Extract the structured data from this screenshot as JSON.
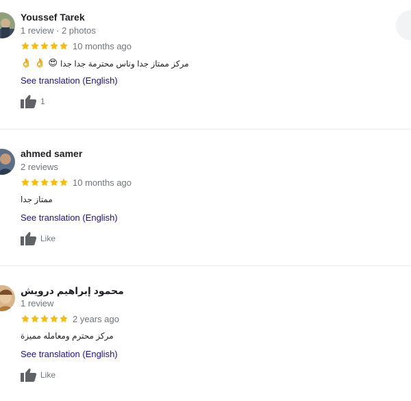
{
  "reviews": [
    {
      "author": "Youssef Tarek",
      "meta": "1 review · 2 photos",
      "rating": 5,
      "date": "10 months ago",
      "text": "مركز ممتاز جدا وناس محترمة جدا جدا",
      "emojis": [
        "😍",
        "👌",
        "👌"
      ],
      "translate_label": "See translation (English)",
      "like_label": "1",
      "avatar_colors": [
        "#6b7a5a",
        "#c9b28d",
        "#3b4a5e"
      ]
    },
    {
      "author": "ahmed samer",
      "meta": "2 reviews",
      "rating": 5,
      "date": "10 months ago",
      "text": "ممتاز جدا",
      "translate_label": "See translation (English)",
      "like_label": "Like",
      "avatar_colors": [
        "#2f3b55",
        "#c49a7a",
        "#5a6f8a"
      ]
    },
    {
      "author": "محمود إبراهيم درويش",
      "meta": "1 review",
      "rating": 5,
      "date": "2 years ago",
      "text": "مركز محترم ومعامله مميزة",
      "translate_label": "See translation (English)",
      "like_label": "Like",
      "avatar_colors": [
        "#b47a3c",
        "#e6c9a0",
        "#7a4e2a"
      ]
    }
  ],
  "colors": {
    "star": "#fbbc04",
    "link": "#1a0dab",
    "muted": "#70757a",
    "text": "#202124",
    "divider": "#e8eaed",
    "like_icon": "#5f6368"
  }
}
